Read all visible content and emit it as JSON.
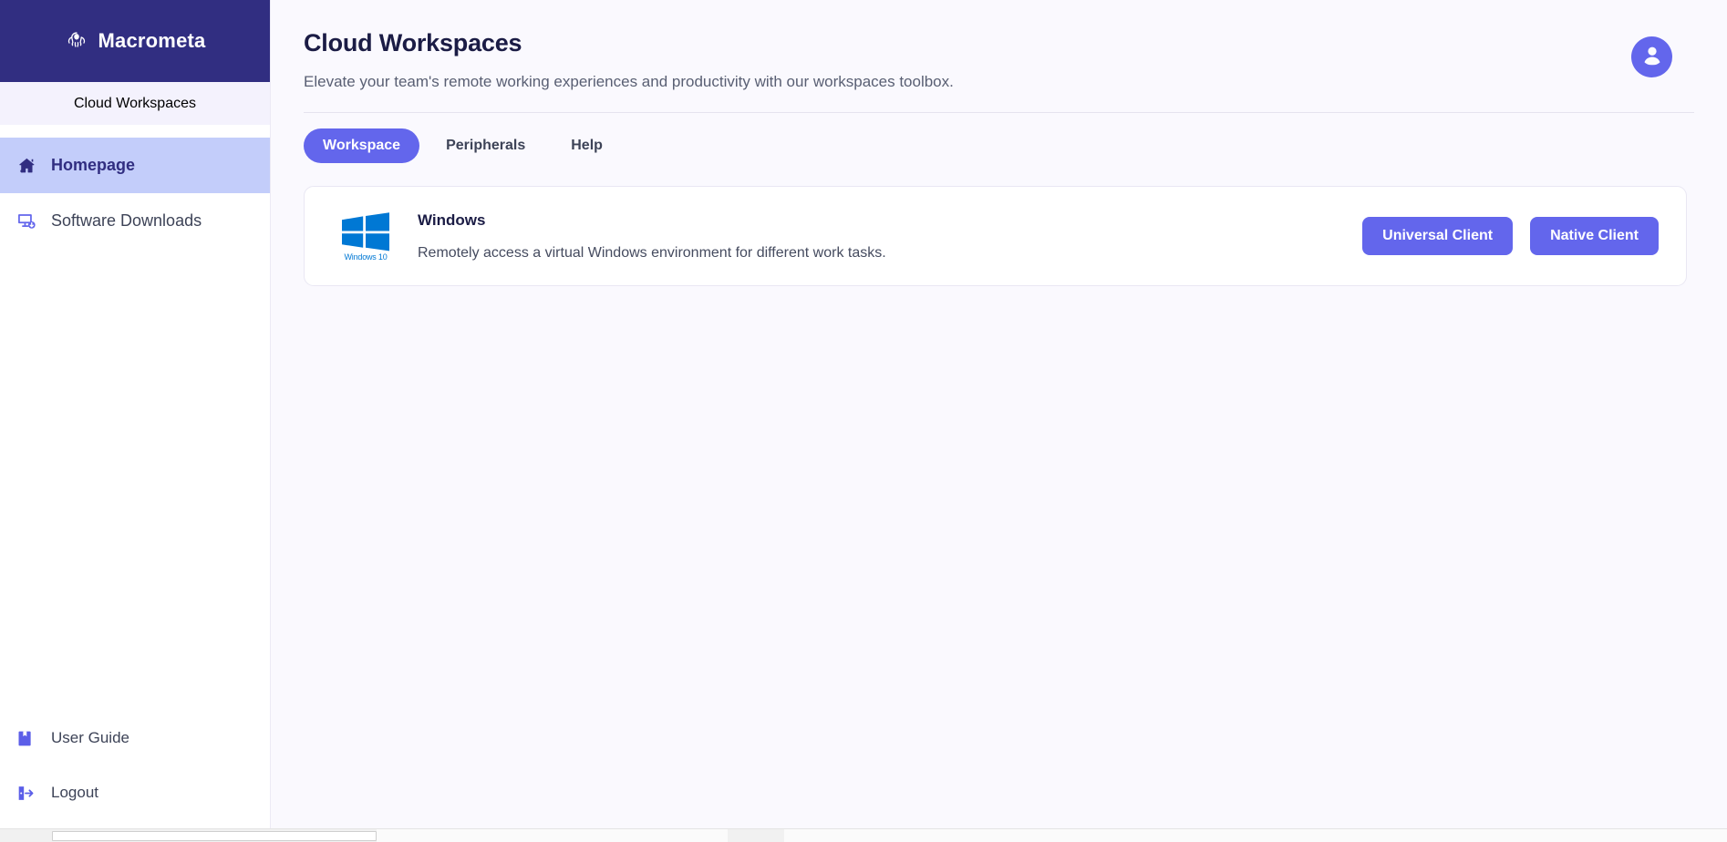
{
  "brand": {
    "name": "Macrometa",
    "logo_icon": "octopus-icon"
  },
  "sidebar": {
    "section_label": "Cloud Workspaces",
    "items": [
      {
        "label": "Homepage",
        "icon": "home-icon",
        "active": true
      },
      {
        "label": "Software Downloads",
        "icon": "monitor-download-icon",
        "active": false
      }
    ],
    "bottom_items": [
      {
        "label": "User Guide",
        "icon": "book-icon"
      },
      {
        "label": "Logout",
        "icon": "logout-icon"
      }
    ]
  },
  "header": {
    "title": "Cloud Workspaces",
    "subtitle": "Elevate your team's remote working experiences and productivity with our workspaces toolbox.",
    "avatar_icon": "user-avatar-icon"
  },
  "tabs": [
    {
      "label": "Workspace",
      "active": true
    },
    {
      "label": "Peripherals",
      "active": false
    },
    {
      "label": "Help",
      "active": false
    }
  ],
  "cards": [
    {
      "logo_icon": "windows-logo-icon",
      "logo_caption": "Windows 10",
      "title": "Windows",
      "description": "Remotely access a virtual Windows environment for different work tasks.",
      "actions": [
        {
          "label": "Universal Client"
        },
        {
          "label": "Native Client"
        }
      ]
    }
  ],
  "colors": {
    "brand_navy": "#312e81",
    "accent_purple": "#6366ec",
    "active_nav_bg": "#c3cdfa",
    "page_bg": "#faf9fe",
    "card_bg": "#ffffff",
    "title_navy": "#1b1c45",
    "windows_blue": "#0078d4"
  }
}
